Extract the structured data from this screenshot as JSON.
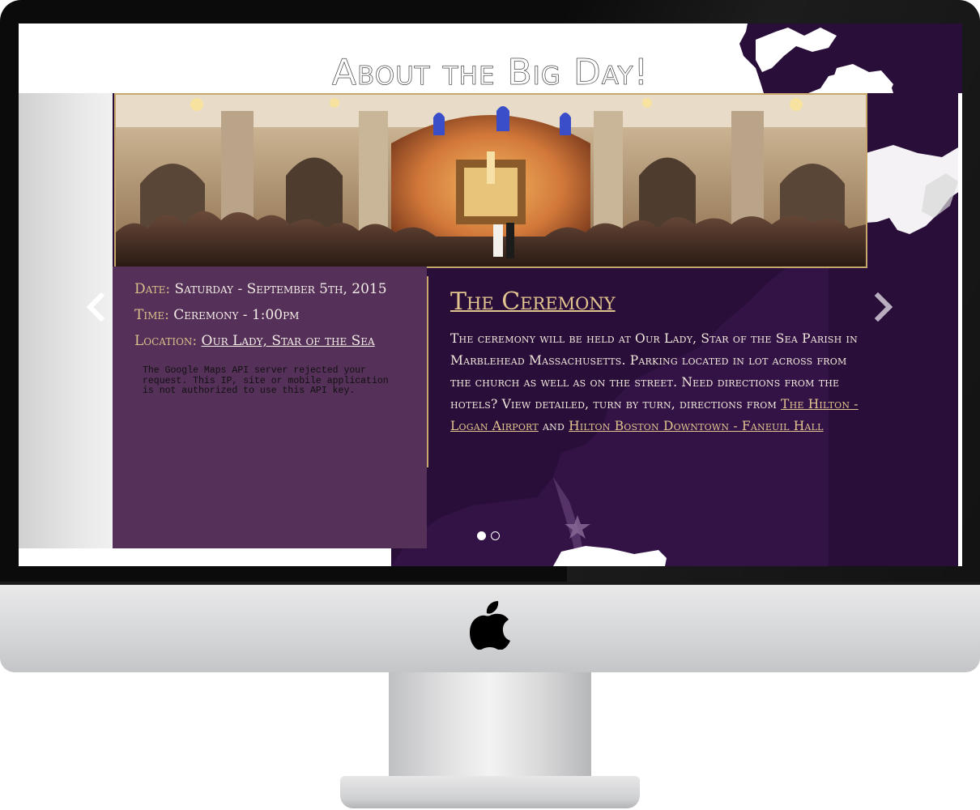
{
  "page": {
    "title": "About the Big Day!"
  },
  "details": {
    "date_label": "Date:",
    "date_value": "Saturday - September 5th, 2015",
    "time_label": "Time:",
    "time_value": "Ceremony - 1:00pm",
    "location_label": "Location:",
    "location_value": "Our Lady, Star of the Sea"
  },
  "map_error": "The Google Maps API server rejected your request. This IP, site or mobile application is not authorized to use this API key.",
  "ceremony": {
    "title": "The Ceremony",
    "body": "The ceremony will be held at Our Lady, Star of the Sea Parish in Marblehead Massachusetts. Parking located in lot across from the church as well as on the street. Need directions from the hotels? View detailed, turn by turn, directions from ",
    "link1": "The Hilton - Logan Airport",
    "conjunction": " and ",
    "link2": "Hilton Boston Downtown - Faneuil Hall"
  },
  "carousel": {
    "slide_count": 2,
    "active_slide": 1
  },
  "icons": {
    "prev": "chevron-left-icon",
    "next": "chevron-right-icon",
    "brand": "apple-logo-icon"
  },
  "colors": {
    "purple_dark": "#2a0e3a",
    "purple_panel": "#553059",
    "gold": "#c7a76b",
    "gold_text": "#e2c58e"
  }
}
